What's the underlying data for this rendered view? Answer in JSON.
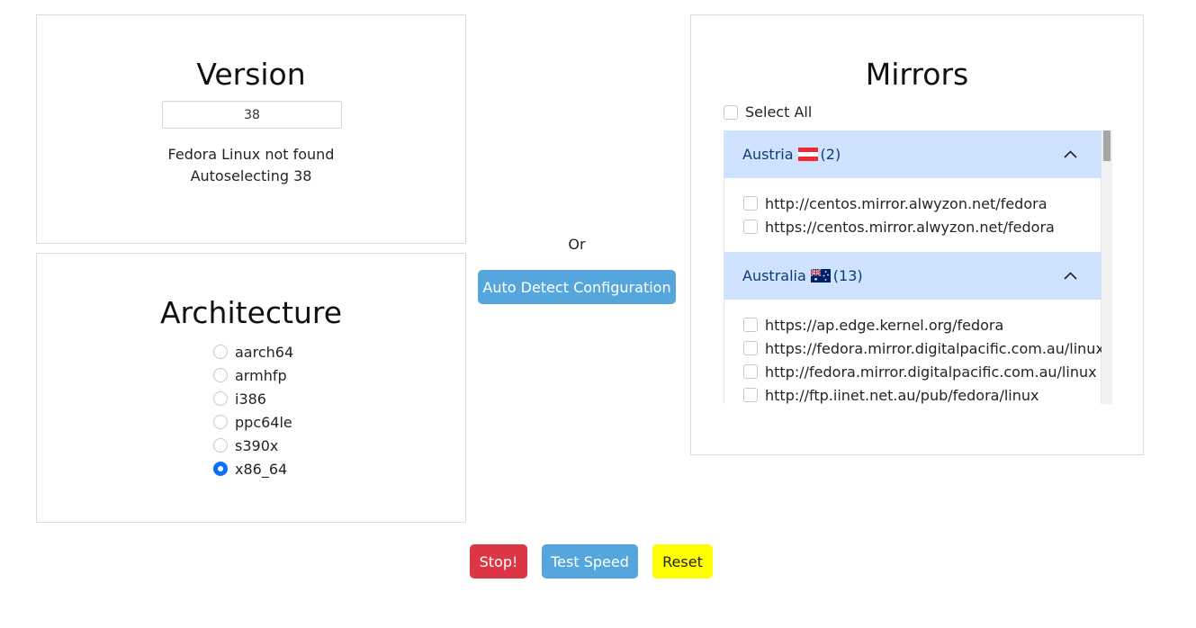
{
  "version": {
    "title": "Version",
    "input_value": "38",
    "status_line1": "Fedora Linux not found",
    "status_line2": "Autoselecting 38"
  },
  "architecture": {
    "title": "Architecture",
    "options": [
      {
        "label": "aarch64",
        "checked": false
      },
      {
        "label": "armhfp",
        "checked": false
      },
      {
        "label": "i386",
        "checked": false
      },
      {
        "label": "ppc64le",
        "checked": false
      },
      {
        "label": "s390x",
        "checked": false
      },
      {
        "label": "x86_64",
        "checked": true
      }
    ]
  },
  "middle": {
    "or_label": "Or",
    "auto_detect_label": "Auto Detect Configuration"
  },
  "mirrors": {
    "title": "Mirrors",
    "select_all_label": "Select All",
    "groups": [
      {
        "country": "Austria",
        "flag_icon": "austria-flag-icon",
        "count": "(2)",
        "items": [
          "http://centos.mirror.alwyzon.net/fedora",
          "https://centos.mirror.alwyzon.net/fedora"
        ]
      },
      {
        "country": "Australia",
        "flag_icon": "australia-flag-icon",
        "count": "(13)",
        "items": [
          "https://ap.edge.kernel.org/fedora",
          "https://fedora.mirror.digitalpacific.com.au/linux",
          "http://fedora.mirror.digitalpacific.com.au/linux",
          "http://ftp.iinet.net.au/pub/fedora/linux"
        ]
      }
    ]
  },
  "actions": {
    "stop_label": "Stop!",
    "test_label": "Test Speed",
    "reset_label": "Reset"
  },
  "colors": {
    "accordion_header": "#cfe2ff",
    "primary_button": "#55a6dc",
    "stop_button": "#dc3545",
    "reset_button": "#ffff00",
    "radio_checked": "#0d6efd"
  }
}
